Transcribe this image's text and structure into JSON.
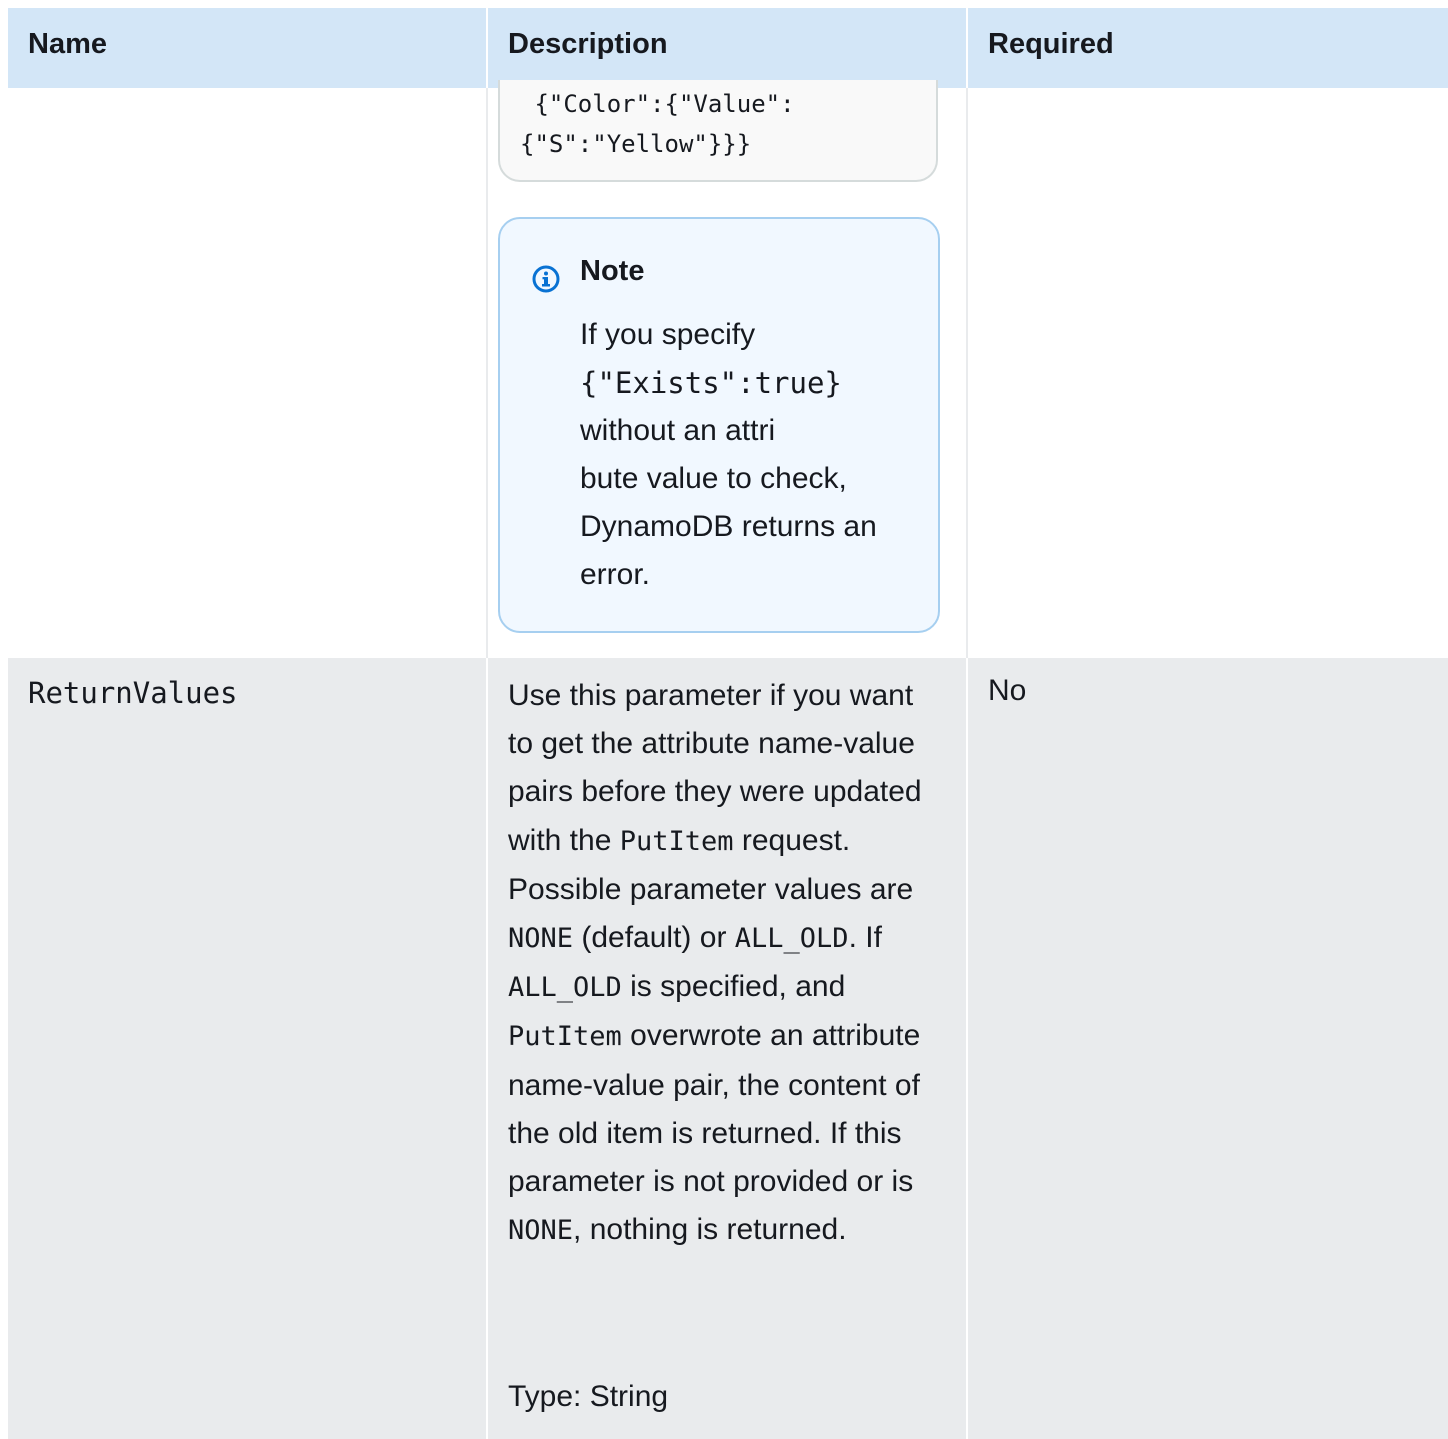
{
  "headers": {
    "name": "Name",
    "description": "Description",
    "required": "Required"
  },
  "code_example": {
    "line1": " {\"Color\":{\"Value\":",
    "line2": "{\"S\":\"Yellow\"}}}"
  },
  "note": {
    "icon": "info-icon",
    "title": "Note",
    "text_1": "If you specify",
    "code_exists": "{\"Exists\":true}",
    "text_2": "without an  attri",
    "text_3": "bute value to check,",
    "text_4": "DynamoDB returns an",
    "text_5": "error."
  },
  "return_values_row": {
    "name": "ReturnValues",
    "desc": {
      "t1": "Use this parameter if you want to get the attribute name-value pairs  before they were updated with the ",
      "c_putitem_1": "PutItem",
      "t2": " request. Possible parameter values are ",
      "c_none_1": "NONE",
      "t3": " (default) or ",
      "c_allold_1": "ALL_OLD",
      "t4": ". If ",
      "c_allold_2": "ALL_OLD",
      "t5": " is specified, and ",
      "c_putitem_2": "PutItem",
      "t6": " overwrote an attribute name-value pair, the content of the old item is returned. If this parameter is not  provided or is ",
      "c_none_2": "NONE",
      "t7": ", nothing is returned."
    },
    "type_text": "Type: String",
    "required": "No"
  },
  "colors": {
    "header_bg": "#d3e6f7",
    "row_alt_bg": "#e9ebed",
    "note_bg": "#f1f8ff",
    "note_border": "#a6cff0",
    "info_icon": "#0972d3"
  }
}
